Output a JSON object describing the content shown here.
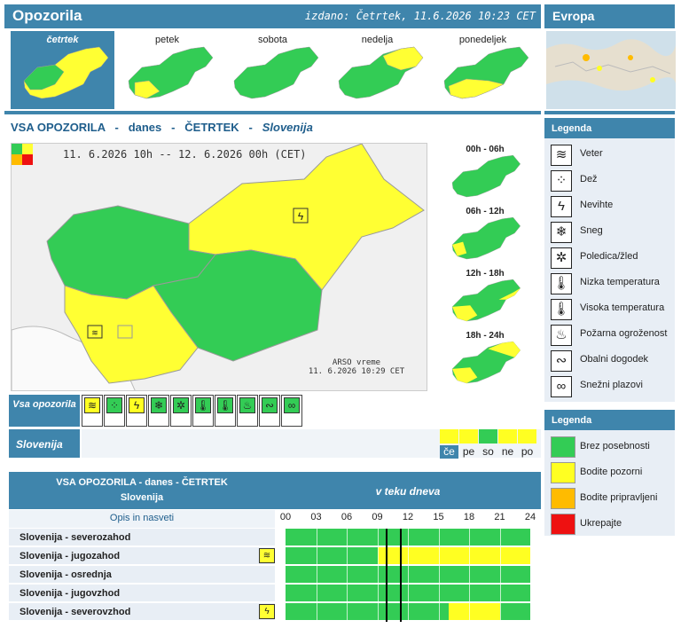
{
  "header": {
    "title": "Opozorila",
    "issued": "izdano: Četrtek, 11.6.2026 10:23 CET"
  },
  "europe": {
    "title": "Evropa"
  },
  "days": [
    {
      "label": "četrtek",
      "selected": true
    },
    {
      "label": "petek",
      "selected": false
    },
    {
      "label": "sobota",
      "selected": false
    },
    {
      "label": "nedelja",
      "selected": false
    },
    {
      "label": "ponedeljek",
      "selected": false
    }
  ],
  "subtitle": {
    "part1": "VSA OPOZORILA",
    "dash1": "-",
    "part2": "danes",
    "dash2": "-",
    "part3": "ČETRTEK",
    "dash3": "-",
    "region": "Slovenija"
  },
  "map": {
    "period": "11. 6.2026 10h -- 12. 6.2026 00h  (CET)",
    "source": "ARSO vreme",
    "source_time": "11. 6.2026  10:29 CET"
  },
  "time_slots": [
    {
      "label": "00h - 06h"
    },
    {
      "label": "06h - 12h"
    },
    {
      "label": "12h - 18h"
    },
    {
      "label": "18h - 24h"
    }
  ],
  "legend_icons": {
    "title": "Legenda",
    "items": [
      {
        "label": "Veter",
        "icon": "wind-icon",
        "glyph": "≋"
      },
      {
        "label": "Dež",
        "icon": "rain-icon",
        "glyph": "⁘"
      },
      {
        "label": "Nevihte",
        "icon": "thunderstorm-icon",
        "glyph": "ϟ"
      },
      {
        "label": "Sneg",
        "icon": "snow-icon",
        "glyph": "❄"
      },
      {
        "label": "Poledica/žled",
        "icon": "ice-icon",
        "glyph": "✲"
      },
      {
        "label": "Nizka temperatura",
        "icon": "low-temperature-icon",
        "glyph": "🌡"
      },
      {
        "label": "Visoka temperatura",
        "icon": "high-temperature-icon",
        "glyph": "🌡"
      },
      {
        "label": "Požarna ogroženost",
        "icon": "fire-icon",
        "glyph": "♨"
      },
      {
        "label": "Obalni dogodek",
        "icon": "coastal-event-icon",
        "glyph": "∾"
      },
      {
        "label": "Snežni plazovi",
        "icon": "avalanche-icon",
        "glyph": "∞"
      }
    ]
  },
  "legend_colors": {
    "title": "Legenda",
    "items": [
      {
        "label": "Brez posebnosti",
        "color": "#33cc55"
      },
      {
        "label": "Bodite pozorni",
        "color": "#ffff22"
      },
      {
        "label": "Bodite pripravljeni",
        "color": "#ffbb00"
      },
      {
        "label": "Ukrepajte",
        "color": "#ee1111"
      }
    ]
  },
  "vsa_label": "Vsa opozorila",
  "hazard_row": [
    {
      "icon": "wind-icon",
      "glyph": "≋",
      "color": "#ffff22"
    },
    {
      "icon": "rain-icon",
      "glyph": "⁘",
      "color": "#33cc55"
    },
    {
      "icon": "thunderstorm-icon",
      "glyph": "ϟ",
      "color": "#ffff22"
    },
    {
      "icon": "snow-icon",
      "glyph": "❄",
      "color": "#33cc55"
    },
    {
      "icon": "ice-icon",
      "glyph": "✲",
      "color": "#33cc55"
    },
    {
      "icon": "low-temperature-icon",
      "glyph": "🌡",
      "color": "#33cc55"
    },
    {
      "icon": "high-temperature-icon",
      "glyph": "🌡",
      "color": "#33cc55"
    },
    {
      "icon": "fire-icon",
      "glyph": "♨",
      "color": "#33cc55"
    },
    {
      "icon": "coastal-event-icon",
      "glyph": "∾",
      "color": "#33cc55"
    },
    {
      "icon": "avalanche-icon",
      "glyph": "∞",
      "color": "#33cc55"
    }
  ],
  "slovenija_label": "Slovenija",
  "day_levels": [
    {
      "label": "če",
      "color": "#ffff22",
      "active": true
    },
    {
      "label": "pe",
      "color": "#ffff22",
      "active": false
    },
    {
      "label": "so",
      "color": "#33cc55",
      "active": false
    },
    {
      "label": "ne",
      "color": "#ffff22",
      "active": false
    },
    {
      "label": "po",
      "color": "#ffff22",
      "active": false
    }
  ],
  "table": {
    "head_left_1": "VSA OPOZORILA - danes - ČETRTEK",
    "head_left_2": "Slovenija",
    "head_right": "v teku dneva",
    "opis": "Opis in nasveti",
    "hours": [
      "00",
      "03",
      "06",
      "09",
      "12",
      "15",
      "18",
      "21",
      "24"
    ],
    "now_hours": [
      9.8,
      11.2
    ],
    "rows": [
      {
        "name": "Slovenija - severozahod",
        "icon": "",
        "segments": [
          {
            "from": 0,
            "to": 24,
            "color": "#33cc55"
          }
        ]
      },
      {
        "name": "Slovenija - jugozahod",
        "icon": "wind-icon",
        "glyph": "≋",
        "segments": [
          {
            "from": 0,
            "to": 9,
            "color": "#33cc55"
          },
          {
            "from": 9,
            "to": 24,
            "color": "#ffff22"
          }
        ]
      },
      {
        "name": "Slovenija - osrednja",
        "icon": "",
        "segments": [
          {
            "from": 0,
            "to": 24,
            "color": "#33cc55"
          }
        ]
      },
      {
        "name": "Slovenija - jugovzhod",
        "icon": "",
        "segments": [
          {
            "from": 0,
            "to": 24,
            "color": "#33cc55"
          }
        ]
      },
      {
        "name": "Slovenija - severovzhod",
        "icon": "thunderstorm-icon",
        "glyph": "ϟ",
        "segments": [
          {
            "from": 0,
            "to": 16,
            "color": "#33cc55"
          },
          {
            "from": 16,
            "to": 21,
            "color": "#ffff22"
          },
          {
            "from": 21,
            "to": 24,
            "color": "#33cc55"
          }
        ]
      }
    ]
  }
}
